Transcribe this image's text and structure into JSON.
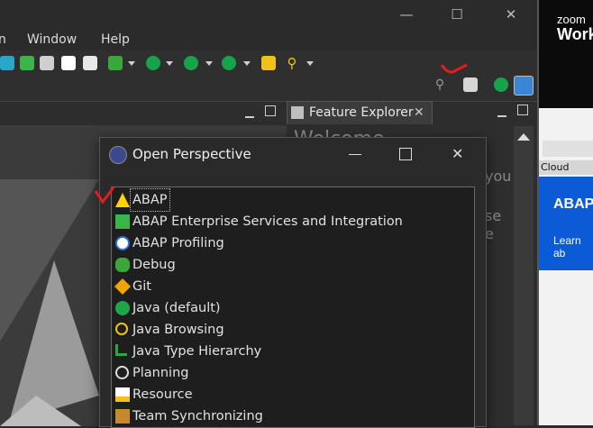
{
  "window": {
    "minimize_glyph": "—",
    "maximize_glyph": "☐",
    "close_glyph": "✕"
  },
  "menu": {
    "items": [
      "n",
      "Window",
      "Help"
    ]
  },
  "toolbar": {
    "icons": [
      "debug-icon",
      "run-icon",
      "coverage-icon",
      "stop-icon",
      "open-folder-icon",
      "search-icon"
    ]
  },
  "feature_explorer": {
    "tab_label": "Feature Explorer",
    "partial_lines": [
      "Welcome",
      "you",
      "se",
      "e"
    ]
  },
  "zoom_app": {
    "brand": "zoom",
    "title_fragment": "Work",
    "browser_tab_label": "Cloud",
    "card_title": "ABAP",
    "card_link": "Learn ab"
  },
  "dialog": {
    "title": "Open Perspective",
    "items": [
      {
        "label": "ABAP",
        "icon": "abap-icon"
      },
      {
        "label": "ABAP Enterprise Services and Integration",
        "icon": "enterprise-services-icon"
      },
      {
        "label": "ABAP Profiling",
        "icon": "profiling-icon"
      },
      {
        "label": "Debug",
        "icon": "debug-icon"
      },
      {
        "label": "Git",
        "icon": "git-icon"
      },
      {
        "label": "Java (default)",
        "icon": "java-icon"
      },
      {
        "label": "Java Browsing",
        "icon": "java-browsing-icon"
      },
      {
        "label": "Java Type Hierarchy",
        "icon": "type-hierarchy-icon"
      },
      {
        "label": "Planning",
        "icon": "planning-icon"
      },
      {
        "label": "Resource",
        "icon": "resource-icon"
      },
      {
        "label": "Team Synchronizing",
        "icon": "team-sync-icon"
      }
    ],
    "selected_index": 0
  }
}
